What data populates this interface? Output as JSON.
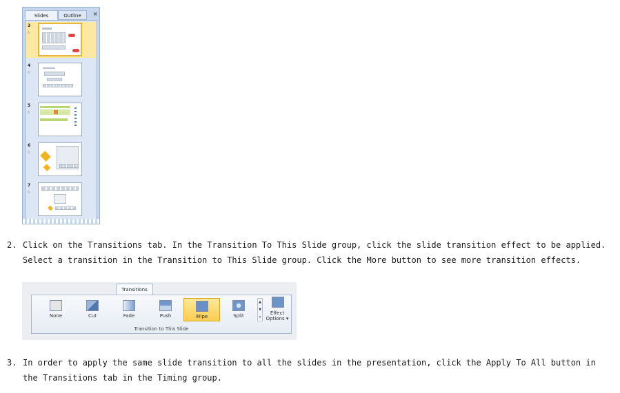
{
  "slides_pane": {
    "tabs": [
      "Slides",
      "Outline"
    ],
    "close_glyph": "×",
    "slide_numbers": [
      "3",
      "4",
      "5",
      "6",
      "7"
    ],
    "selected_slide": "3",
    "star_glyph": "☆"
  },
  "steps": [
    {
      "number": "2.",
      "text": "Click on the Transitions tab. In the Transition To This Slide group, click the slide transition effect to be applied. Select a transition in the Transition to This Slide group. Click the More button to see more transition effects."
    },
    {
      "number": "3.",
      "text": "In order to apply the same slide transition to all the slides in the presentation, click the Apply To All button in the Transitions tab in the Timing group."
    }
  ],
  "ribbon": {
    "tab_label": "Transitions",
    "items": [
      "None",
      "Cut",
      "Fade",
      "Push",
      "Wipe",
      "Split"
    ],
    "selected_item": "Wipe",
    "effect_options": "Effect Options ▾",
    "group_label": "Transition to This Slide",
    "scroll_up": "▲",
    "scroll_down": "▼"
  },
  "colors": {
    "pane_background": "#c6d6ec",
    "selected_highlight": "#fbe9a3",
    "ribbon_selected": "#f9cd4f"
  }
}
